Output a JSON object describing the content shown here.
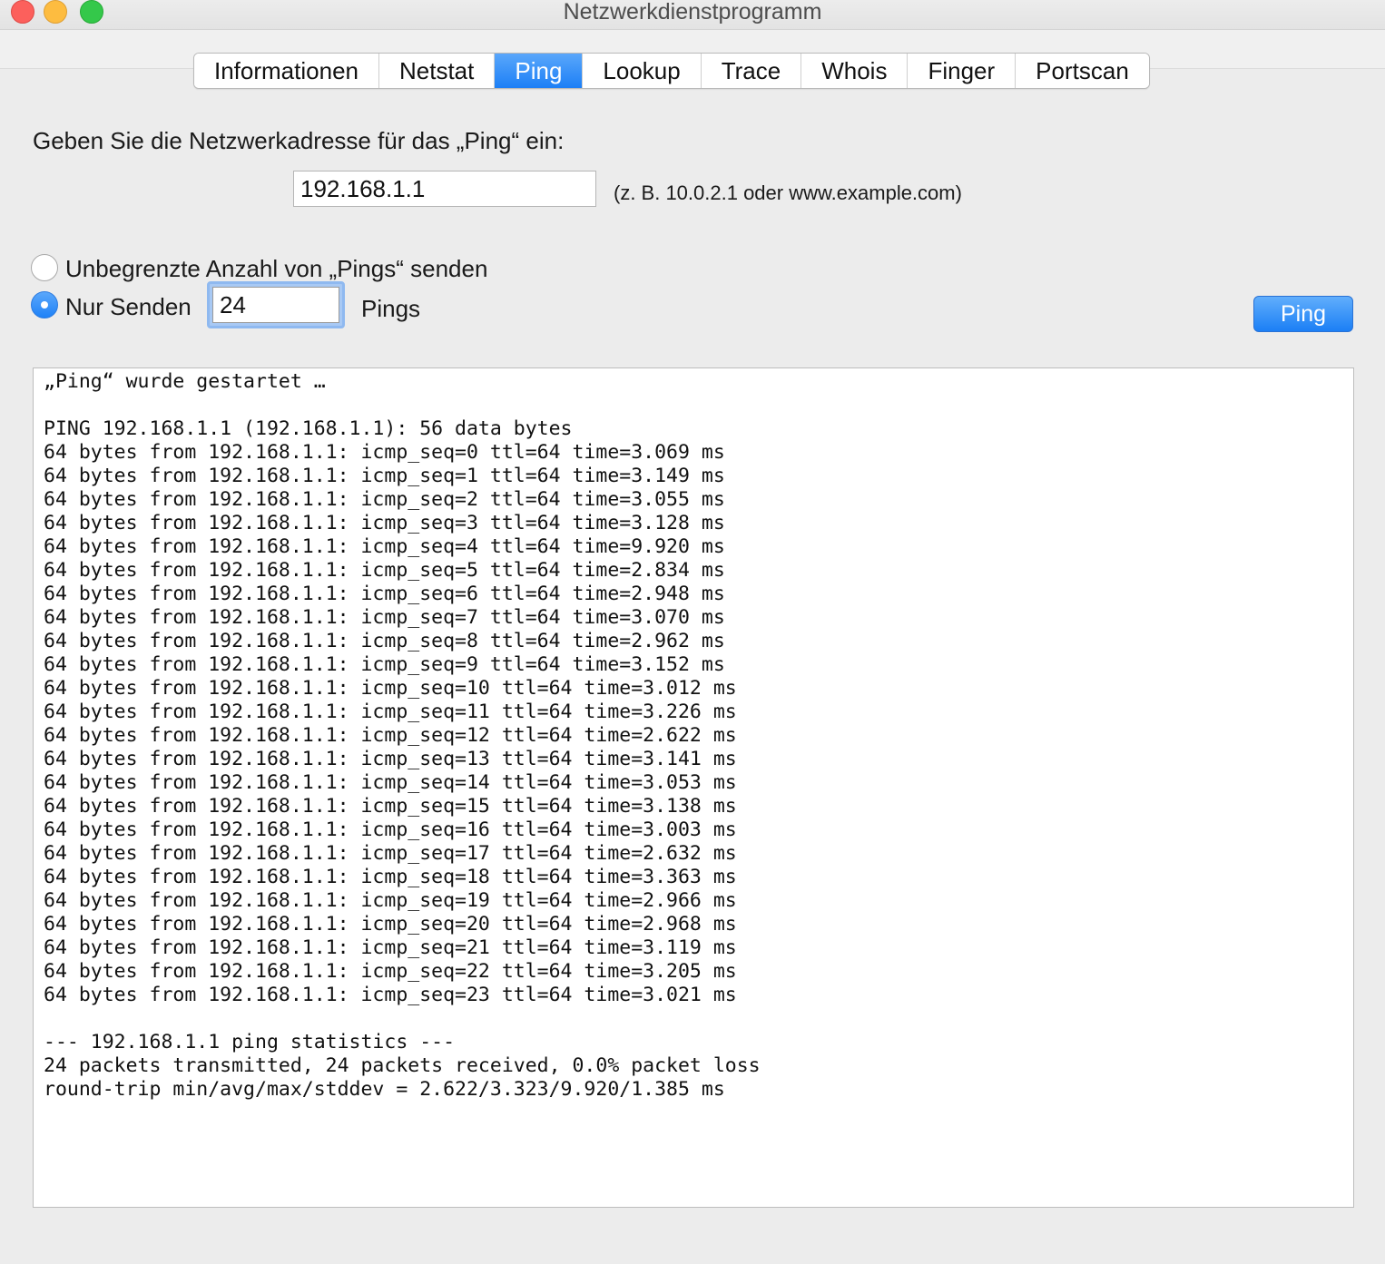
{
  "window": {
    "title": "Netzwerkdienstprogramm"
  },
  "tabs": [
    {
      "label": "Informationen",
      "active": false
    },
    {
      "label": "Netstat",
      "active": false
    },
    {
      "label": "Ping",
      "active": true
    },
    {
      "label": "Lookup",
      "active": false
    },
    {
      "label": "Trace",
      "active": false
    },
    {
      "label": "Whois",
      "active": false
    },
    {
      "label": "Finger",
      "active": false
    },
    {
      "label": "Portscan",
      "active": false
    }
  ],
  "form": {
    "prompt": "Geben Sie die Netzwerkadresse für das „Ping“ ein:",
    "address_value": "192.168.1.1",
    "example_hint": "(z. B. 10.0.2.1 oder www.example.com)",
    "unlimited_label": "Unbegrenzte Anzahl von „Pings“ senden",
    "only_send_label": "Nur Senden",
    "count_value": "24",
    "pings_suffix": "Pings",
    "selected_option": "only_send",
    "ping_button": "Ping"
  },
  "output": {
    "lines": [
      "„Ping“ wurde gestartet …",
      "",
      "PING 192.168.1.1 (192.168.1.1): 56 data bytes",
      "64 bytes from 192.168.1.1: icmp_seq=0 ttl=64 time=3.069 ms",
      "64 bytes from 192.168.1.1: icmp_seq=1 ttl=64 time=3.149 ms",
      "64 bytes from 192.168.1.1: icmp_seq=2 ttl=64 time=3.055 ms",
      "64 bytes from 192.168.1.1: icmp_seq=3 ttl=64 time=3.128 ms",
      "64 bytes from 192.168.1.1: icmp_seq=4 ttl=64 time=9.920 ms",
      "64 bytes from 192.168.1.1: icmp_seq=5 ttl=64 time=2.834 ms",
      "64 bytes from 192.168.1.1: icmp_seq=6 ttl=64 time=2.948 ms",
      "64 bytes from 192.168.1.1: icmp_seq=7 ttl=64 time=3.070 ms",
      "64 bytes from 192.168.1.1: icmp_seq=8 ttl=64 time=2.962 ms",
      "64 bytes from 192.168.1.1: icmp_seq=9 ttl=64 time=3.152 ms",
      "64 bytes from 192.168.1.1: icmp_seq=10 ttl=64 time=3.012 ms",
      "64 bytes from 192.168.1.1: icmp_seq=11 ttl=64 time=3.226 ms",
      "64 bytes from 192.168.1.1: icmp_seq=12 ttl=64 time=2.622 ms",
      "64 bytes from 192.168.1.1: icmp_seq=13 ttl=64 time=3.141 ms",
      "64 bytes from 192.168.1.1: icmp_seq=14 ttl=64 time=3.053 ms",
      "64 bytes from 192.168.1.1: icmp_seq=15 ttl=64 time=3.138 ms",
      "64 bytes from 192.168.1.1: icmp_seq=16 ttl=64 time=3.003 ms",
      "64 bytes from 192.168.1.1: icmp_seq=17 ttl=64 time=2.632 ms",
      "64 bytes from 192.168.1.1: icmp_seq=18 ttl=64 time=3.363 ms",
      "64 bytes from 192.168.1.1: icmp_seq=19 ttl=64 time=2.966 ms",
      "64 bytes from 192.168.1.1: icmp_seq=20 ttl=64 time=2.968 ms",
      "64 bytes from 192.168.1.1: icmp_seq=21 ttl=64 time=3.119 ms",
      "64 bytes from 192.168.1.1: icmp_seq=22 ttl=64 time=3.205 ms",
      "64 bytes from 192.168.1.1: icmp_seq=23 ttl=64 time=3.021 ms",
      "",
      "--- 192.168.1.1 ping statistics ---",
      "24 packets transmitted, 24 packets received, 0.0% packet loss",
      "round-trip min/avg/max/stddev = 2.622/3.323/9.920/1.385 ms"
    ]
  },
  "colors": {
    "accent": "#1c7ff6",
    "window_bg": "#ececec",
    "close": "#fc605c",
    "minimize": "#fdbc40",
    "zoom": "#34c84a"
  }
}
